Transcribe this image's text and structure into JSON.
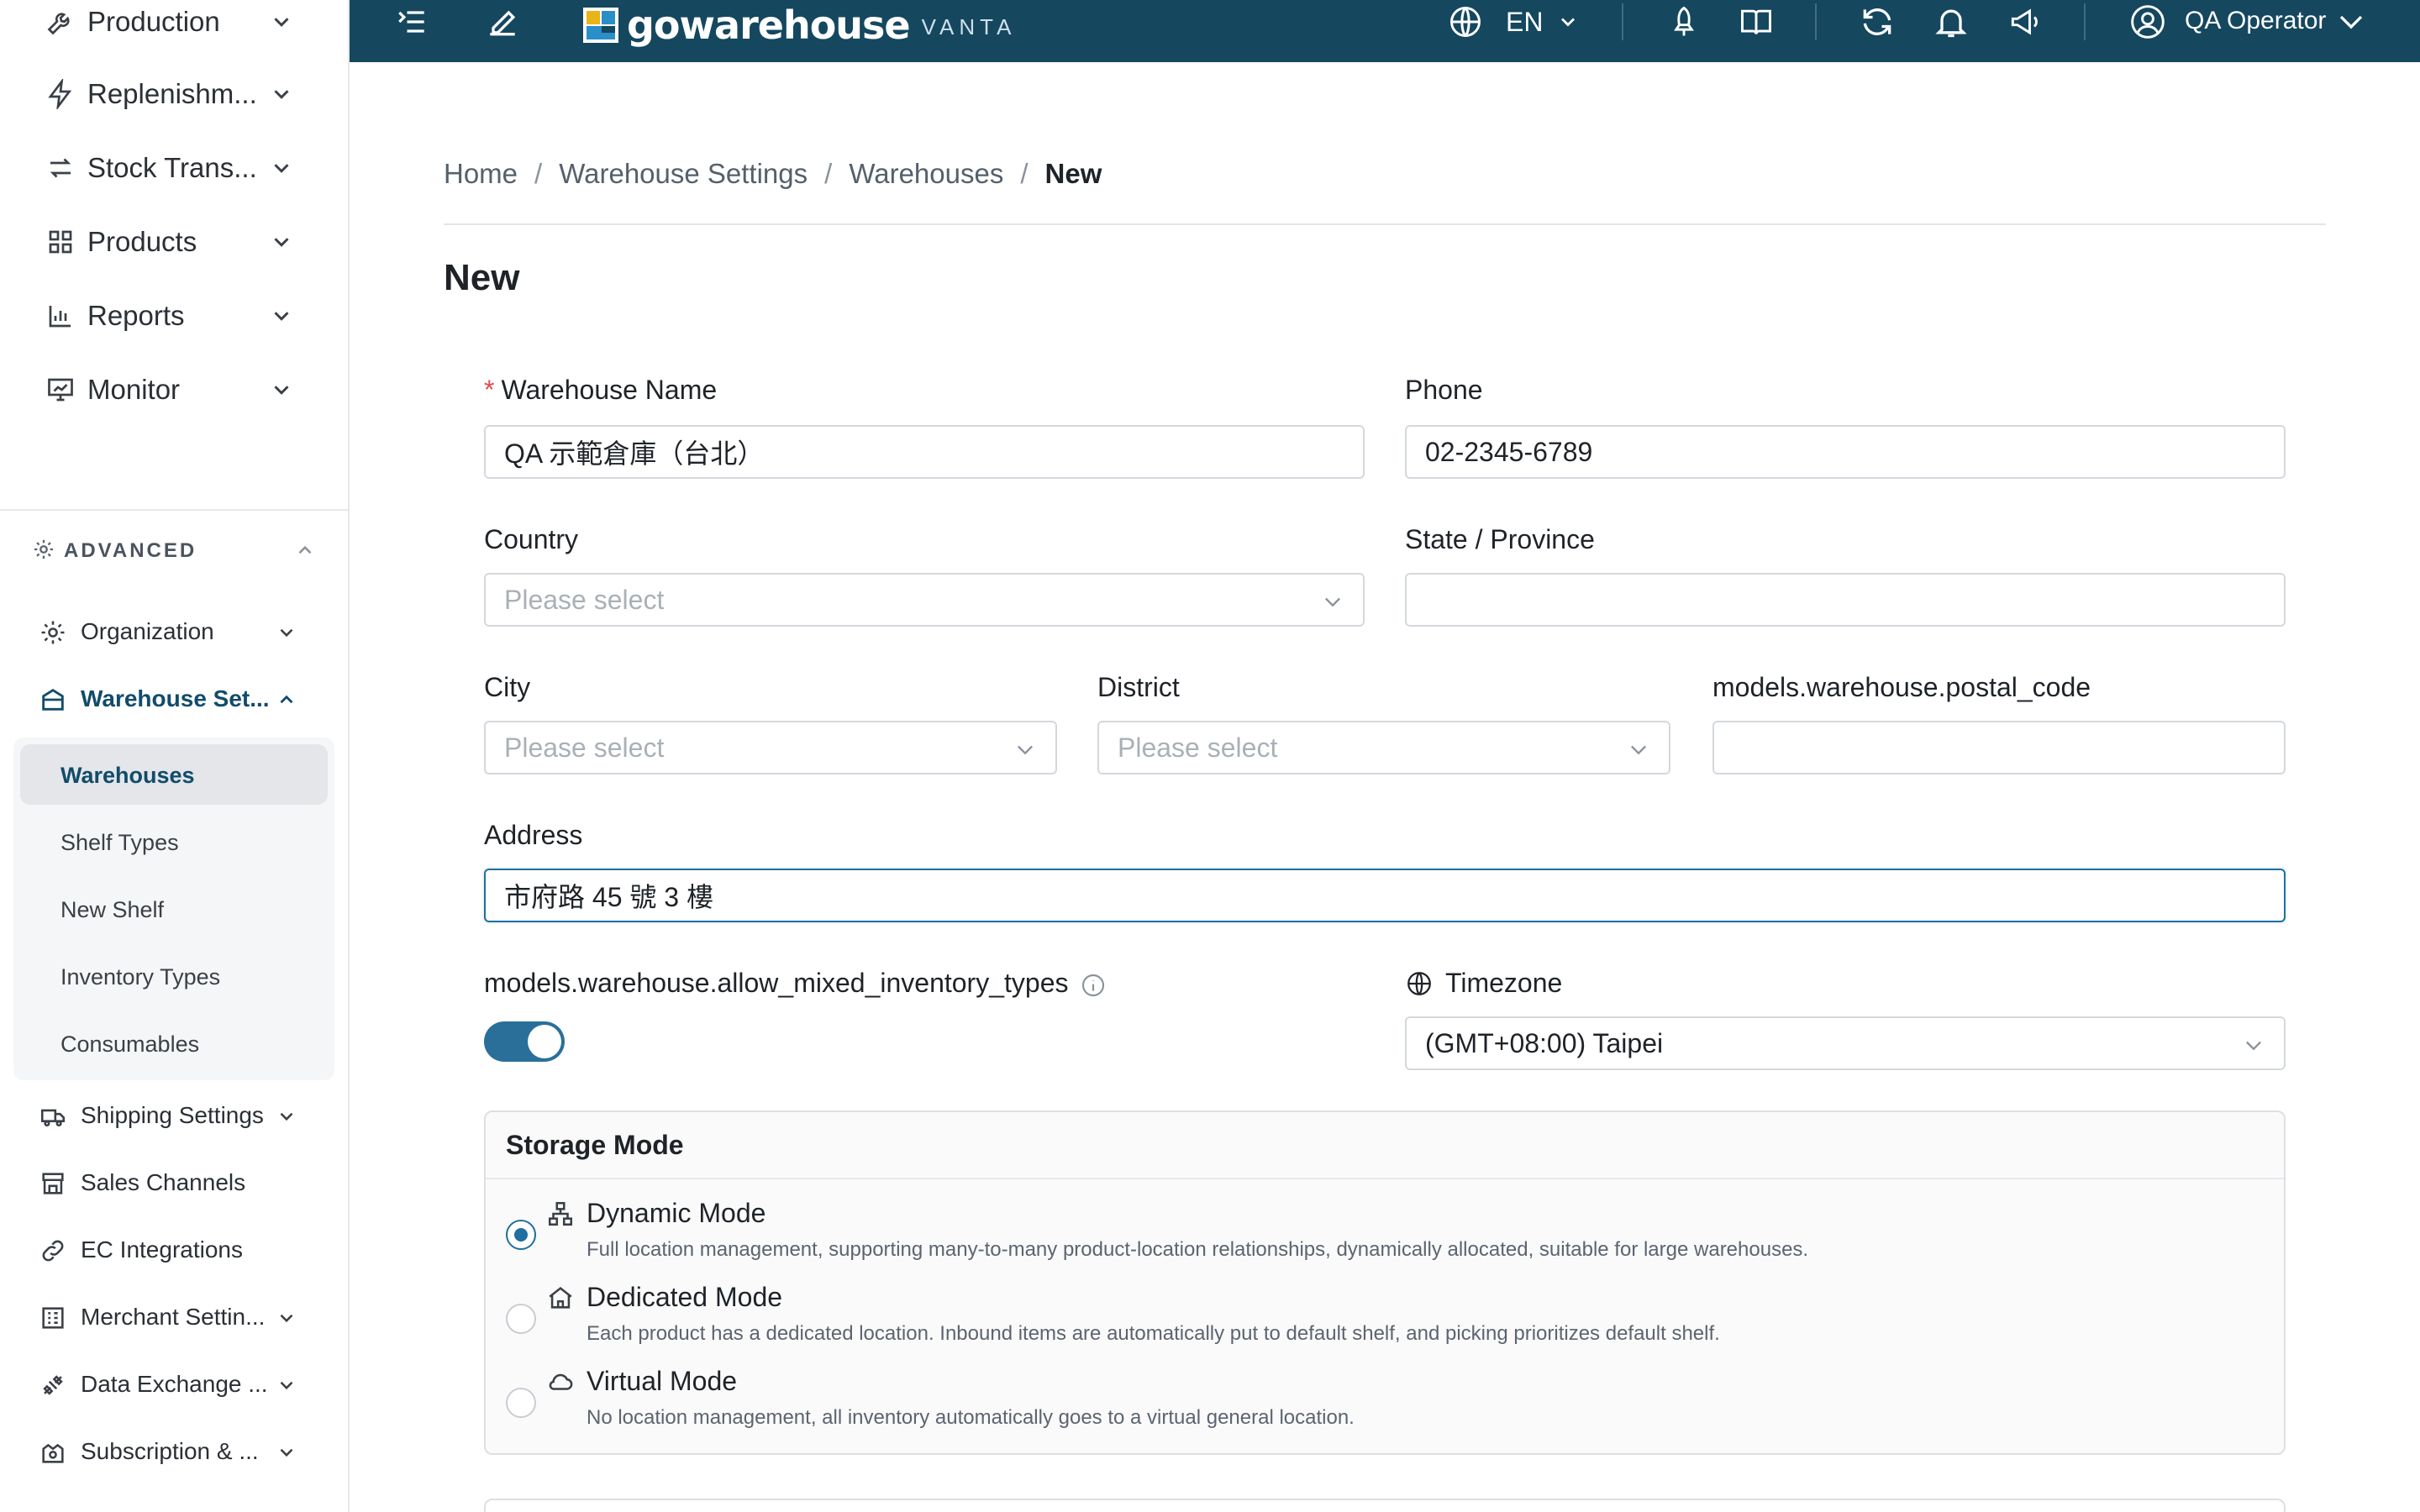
{
  "sidebar": {
    "top_items": [
      {
        "label": "Production",
        "icon": "wrench-icon"
      },
      {
        "label": "Replenishm...",
        "icon": "lightning-icon"
      },
      {
        "label": "Stock Trans...",
        "icon": "transfer-icon"
      },
      {
        "label": "Products",
        "icon": "grid-icon"
      },
      {
        "label": "Reports",
        "icon": "bar-chart-icon"
      },
      {
        "label": "Monitor",
        "icon": "monitor-icon"
      }
    ],
    "advanced": {
      "label": "ADVANCED",
      "items": [
        {
          "label": "Organization",
          "icon": "gear-icon"
        },
        {
          "label": "Warehouse Set...",
          "icon": "warehouse-icon",
          "active": true
        },
        {
          "label": "Shipping Settings",
          "icon": "truck-icon"
        },
        {
          "label": "Sales Channels",
          "icon": "store-icon"
        },
        {
          "label": "EC Integrations",
          "icon": "link-icon"
        },
        {
          "label": "Merchant Settin...",
          "icon": "merchant-icon"
        },
        {
          "label": "Data Exchange ...",
          "icon": "exchange-icon"
        },
        {
          "label": "Subscription & ...",
          "icon": "subscription-icon"
        }
      ],
      "warehouse_submenu": [
        {
          "label": "Warehouses",
          "active": true
        },
        {
          "label": "Shelf Types"
        },
        {
          "label": "New Shelf"
        },
        {
          "label": "Inventory Types"
        },
        {
          "label": "Consumables"
        }
      ]
    }
  },
  "header": {
    "logo_word": "gowarehouse",
    "logo_sub": "VANTA",
    "language": "EN",
    "user_name": "QA Operator",
    "accent": "#15475f"
  },
  "breadcrumb": {
    "items": [
      "Home",
      "Warehouse Settings",
      "Warehouses",
      "New"
    ],
    "separator": "/"
  },
  "page": {
    "title": "New"
  },
  "form": {
    "warehouse_name": {
      "label": "Warehouse Name",
      "required_mark": "*",
      "value": "QA 示範倉庫（台北）"
    },
    "phone": {
      "label": "Phone",
      "value": "02-2345-6789"
    },
    "country": {
      "label": "Country",
      "placeholder": "Please select"
    },
    "state": {
      "label": "State / Province",
      "value": ""
    },
    "city": {
      "label": "City",
      "placeholder": "Please select"
    },
    "district": {
      "label": "District",
      "placeholder": "Please select"
    },
    "postal_code": {
      "label": "models.warehouse.postal_code",
      "value": ""
    },
    "address": {
      "label": "Address",
      "value": "市府路 45 號 3 樓"
    },
    "allow_mixed": {
      "label": "models.warehouse.allow_mixed_inventory_types",
      "enabled": true
    },
    "timezone": {
      "label": "Timezone",
      "value": "(GMT+08:00) Taipei"
    }
  },
  "storage_mode": {
    "title": "Storage Mode",
    "options": [
      {
        "title": "Dynamic Mode",
        "icon": "hierarchy-icon",
        "selected": true,
        "desc": "Full location management, supporting many-to-many product-location relationships, dynamically allocated, suitable for large warehouses."
      },
      {
        "title": "Dedicated Mode",
        "icon": "home-icon",
        "selected": false,
        "desc": "Each product has a dedicated location. Inbound items are automatically put to default shelf, and picking prioritizes default shelf."
      },
      {
        "title": "Virtual Mode",
        "icon": "cloud-icon",
        "selected": false,
        "desc": "No location management, all inventory automatically goes to a virtual general location."
      }
    ]
  }
}
